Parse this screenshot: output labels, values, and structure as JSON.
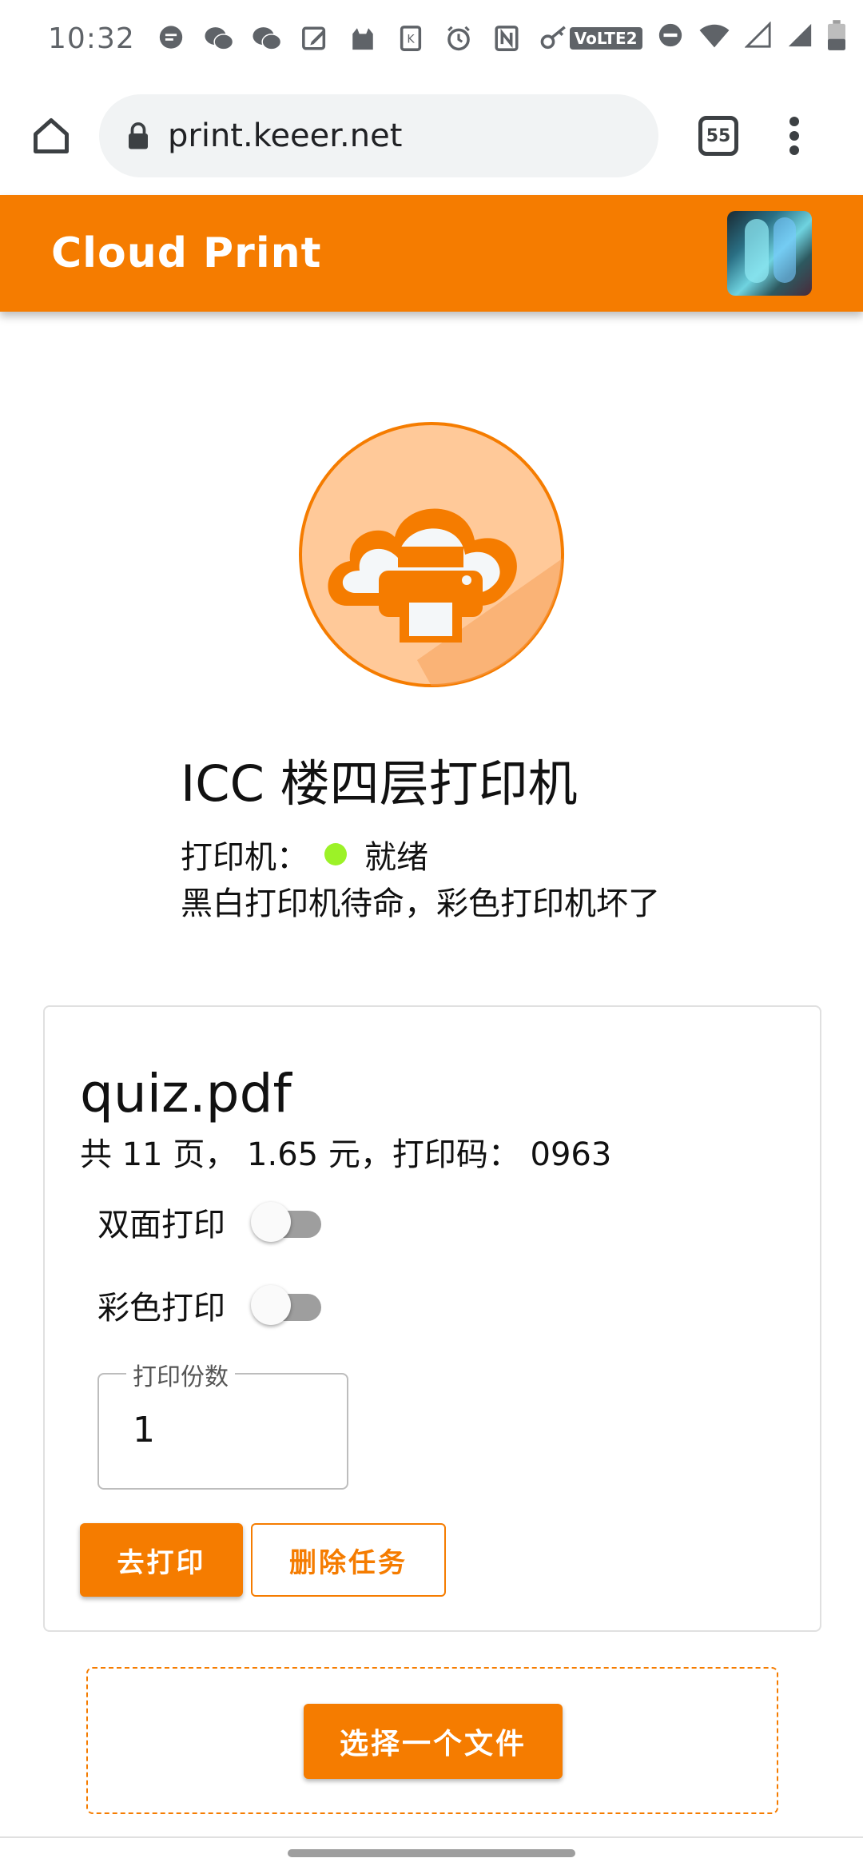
{
  "status_bar": {
    "time": "10:32",
    "icons": [
      "message-icon",
      "wechat-icon",
      "wechat-icon",
      "edit-icon",
      "cat-icon",
      "k-icon",
      "alarm-icon",
      "nfc-icon",
      "key-icon"
    ],
    "volte_label": "VoLTE2",
    "right_icons": [
      "dnd-icon",
      "wifi-icon",
      "signal-icon",
      "signal-icon",
      "battery-icon"
    ]
  },
  "browser": {
    "url": "print.keeer.net",
    "tab_count": "55"
  },
  "app_bar": {
    "title": "Cloud Print"
  },
  "printer": {
    "name": "ICC 楼四层打印机",
    "status_label": "打印机：",
    "status_value": "就绪",
    "status_color": "#9cf227",
    "note": "黑白打印机待命，彩色打印机坏了"
  },
  "job": {
    "file_name": "quiz.pdf",
    "meta": "共 11 页， 1.65 元，打印码： 0963",
    "duplex_label": "双面打印",
    "duplex_on": false,
    "color_label": "彩色打印",
    "color_on": false,
    "copies_label": "打印份数",
    "copies_value": "1",
    "print_button": "去打印",
    "delete_button": "删除任务"
  },
  "upload": {
    "choose_button": "选择一个文件"
  },
  "colors": {
    "accent": "#f57c00",
    "accent_light": "#ffc999"
  }
}
